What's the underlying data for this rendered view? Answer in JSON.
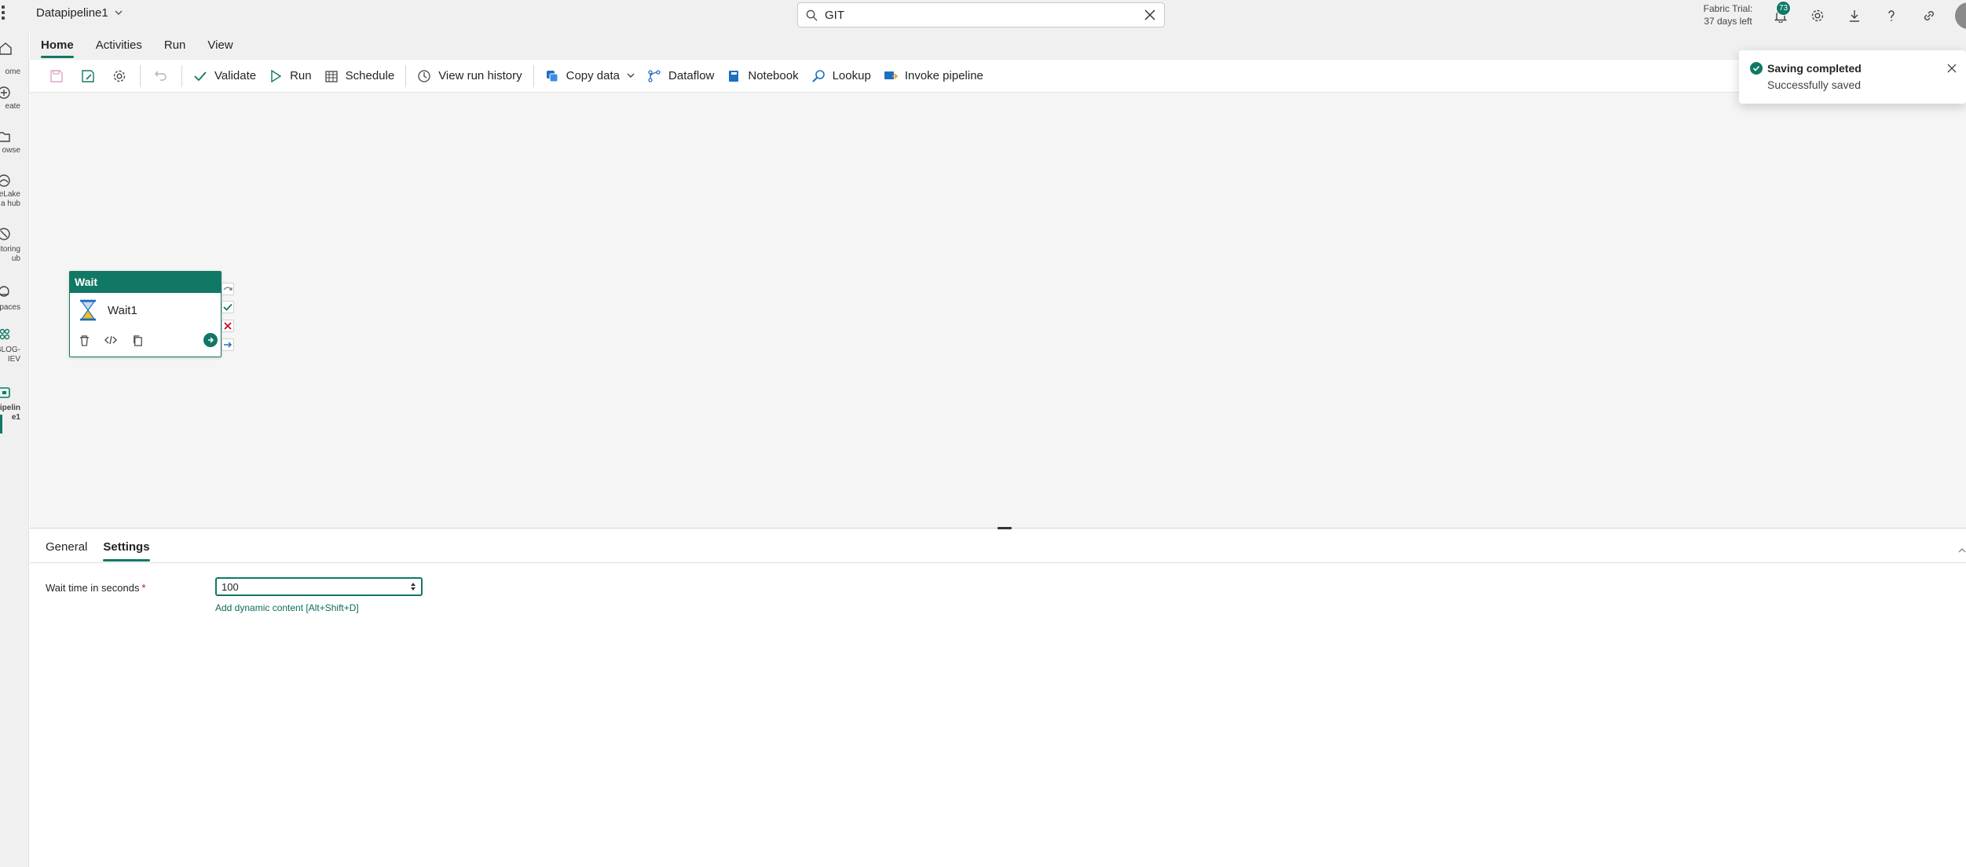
{
  "app": {
    "title": "Datapipeline1"
  },
  "search": {
    "value": "GIT"
  },
  "trial": {
    "line1": "Fabric Trial:",
    "line2": "37 days left"
  },
  "notifications": {
    "count": "73"
  },
  "nav": {
    "items": [
      {
        "label": "ome"
      },
      {
        "label": "eate"
      },
      {
        "label": "owse"
      },
      {
        "label": "eLake\na hub"
      },
      {
        "label": "itoring\nub"
      },
      {
        "label": "spaces"
      },
      {
        "label": "BLOG-\nIEV"
      },
      {
        "label": "pipelin\ne1"
      }
    ]
  },
  "tabs": [
    "Home",
    "Activities",
    "Run",
    "View"
  ],
  "ribbon": {
    "validate": "Validate",
    "run": "Run",
    "schedule": "Schedule",
    "view_run_history": "View run history",
    "copy_data": "Copy data",
    "dataflow": "Dataflow",
    "notebook": "Notebook",
    "lookup": "Lookup",
    "invoke_pipeline": "Invoke pipeline"
  },
  "activity": {
    "type": "Wait",
    "name": "Wait1"
  },
  "panel": {
    "tabs": [
      "General",
      "Settings"
    ],
    "active_tab": "Settings",
    "field_label": "Wait time in seconds",
    "required_mark": "*",
    "field_value": "100",
    "dynamic_link": "Add dynamic content [Alt+Shift+D]"
  },
  "toast": {
    "title": "Saving completed",
    "message": "Successfully saved"
  },
  "colors": {
    "accent": "#117865",
    "error": "#c50f1f",
    "link": "#0f6b5c"
  }
}
